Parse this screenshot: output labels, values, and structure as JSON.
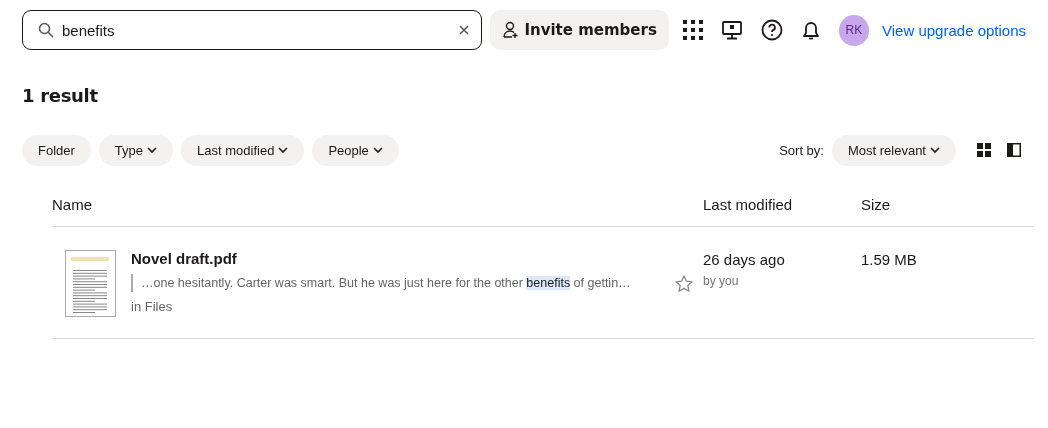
{
  "search": {
    "value": "benefits"
  },
  "header": {
    "invite_button": "Invite members",
    "avatar": "RK",
    "upgrade_link": "View upgrade options"
  },
  "result_count": "1 result",
  "filters": [
    {
      "label": "Folder",
      "dropdown": false
    },
    {
      "label": "Type",
      "dropdown": true
    },
    {
      "label": "Last modified",
      "dropdown": true
    },
    {
      "label": "People",
      "dropdown": true
    }
  ],
  "sort": {
    "label": "Sort by:",
    "value": "Most relevant"
  },
  "views": [
    {
      "kind": "grid"
    },
    {
      "kind": "panel"
    }
  ],
  "table": {
    "columns": [
      "Name",
      "Last modified",
      "Size"
    ],
    "rows": [
      {
        "name": "Novel draft.pdf",
        "snippet": {
          "before": "…one hesitantly. Carter was smart. But he was just here for the other ",
          "match": "benefits",
          "after": " of gettin…"
        },
        "location": "in Files",
        "starred": false,
        "modified": "26 days ago",
        "modified_by": "by you",
        "size": "1.59 MB"
      }
    ]
  }
}
